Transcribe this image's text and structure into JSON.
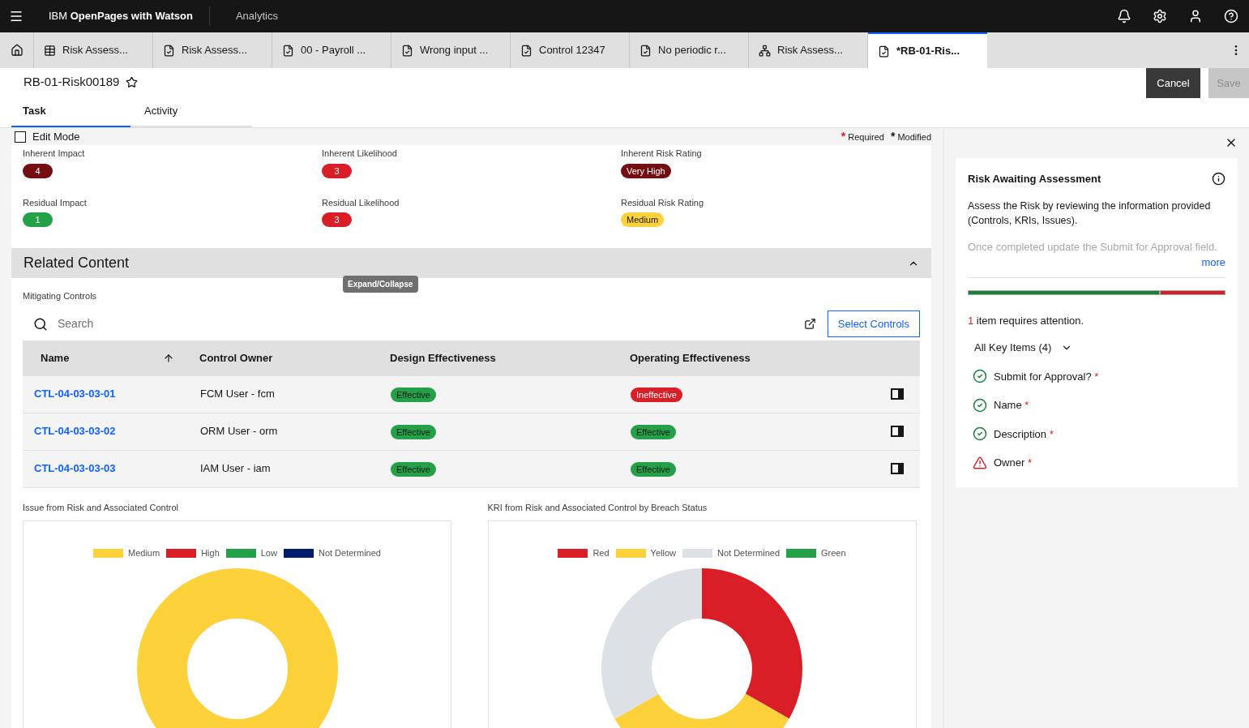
{
  "header": {
    "product": "IBM **OpenPages with Watson**",
    "section": "Analytics"
  },
  "tabs": [
    {
      "label": "Risk Assess...",
      "kind": "table",
      "selected": false
    },
    {
      "label": "Risk Assess...",
      "kind": "document",
      "selected": false
    },
    {
      "label": "00 - Payroll ...",
      "kind": "document",
      "selected": false
    },
    {
      "label": "Wrong input ...",
      "kind": "document",
      "selected": false
    },
    {
      "label": "Control 12347",
      "kind": "document",
      "selected": false
    },
    {
      "label": "No periodic r...",
      "kind": "document",
      "selected": false
    },
    {
      "label": "Risk Assess...",
      "kind": "hierarchy",
      "selected": false
    },
    {
      "label": "*RB-01-Ris...",
      "kind": "document",
      "selected": true
    }
  ],
  "page": {
    "title": "RB-01-Risk00189",
    "favorite": false,
    "buttons": [
      {
        "label": "Cancel",
        "disabled": false
      },
      {
        "label": "Save",
        "disabled": true
      }
    ]
  },
  "view_tabs": [
    {
      "label": "Task",
      "selected": true
    },
    {
      "label": "Activity",
      "selected": false
    }
  ],
  "edit_mode": {
    "label": "Edit Mode",
    "checked": false
  },
  "legend_notes": [
    {
      "mark": "*",
      "label": "Required",
      "color": "#da1e28"
    },
    {
      "mark": "*",
      "label": "Modified",
      "color": "#161616"
    }
  ],
  "ratings": [
    {
      "label": "Inherent Impact",
      "value": "4",
      "color": "#750e13"
    },
    {
      "label": "Inherent Likelihood",
      "value": "3",
      "color": "#da1e28"
    },
    {
      "label": "Inherent Risk Rating",
      "value": "Very High",
      "color": "#750e13"
    },
    {
      "label": "Residual Impact",
      "value": "1",
      "color": "#24a148"
    },
    {
      "label": "Residual Likelihood",
      "value": "3",
      "color": "#da1e28"
    },
    {
      "label": "Residual Risk Rating",
      "value": "Medium",
      "color": "#fdd13a"
    }
  ],
  "related": {
    "title": "Related Content",
    "expanded": true,
    "tooltip": "Expand/Collapse"
  },
  "controls": {
    "label": "Mitigating Controls",
    "search_placeholder": "Search",
    "button": "Select Controls",
    "columns": [
      "Name",
      "Control Owner",
      "Design Effectiveness",
      "Operating Effectiveness"
    ],
    "rows": [
      {
        "name": "CTL-04-03-03-01",
        "owner": "FCM User - fcm",
        "design": {
          "text": "Effective",
          "color": "#24a148"
        },
        "operating": {
          "text": "Ineffective",
          "color": "#da1e28"
        }
      },
      {
        "name": "CTL-04-03-03-02",
        "owner": "ORM User - orm",
        "design": {
          "text": "Effective",
          "color": "#24a148"
        },
        "operating": {
          "text": "Effective",
          "color": "#24a148"
        }
      },
      {
        "name": "CTL-04-03-03-03",
        "owner": "IAM User - iam",
        "design": {
          "text": "Effective",
          "color": "#24a148"
        },
        "operating": {
          "text": "Effective",
          "color": "#24a148"
        }
      }
    ]
  },
  "charts": [
    {
      "title": "Issue from Risk and Associated Control",
      "kind": "full",
      "legend": [
        {
          "label": "Medium",
          "color": "#fdd13a"
        },
        {
          "label": "High",
          "color": "#da1e28"
        },
        {
          "label": "Low",
          "color": "#24a148"
        },
        {
          "label": "Not Determined",
          "color": "#001d6c"
        }
      ]
    },
    {
      "title": "KRI from Risk and Associated Control by Breach Status",
      "kind": "split",
      "legend": [
        {
          "label": "Red",
          "color": "#da1e28"
        },
        {
          "label": "Yellow",
          "color": "#fdd13a"
        },
        {
          "label": "Not Determined",
          "color": "#dde1e6"
        },
        {
          "label": "Green",
          "color": "#24a148"
        }
      ]
    }
  ],
  "panel": {
    "title": "Risk Awaiting Assessment",
    "text": "Assess the Risk by reviewing the information provided (Controls, KRIs, Issues).",
    "text2": "Once completed update the Submit for Approval field.",
    "more": "more",
    "progress": {
      "level": 0.75
    },
    "attention_count": "1",
    "attention_text": "item requires attention.",
    "filter": "All Key Items (4)",
    "items": [
      {
        "label": "Submit for Approval?",
        "kind": "ok"
      },
      {
        "label": "Name",
        "kind": "ok"
      },
      {
        "label": "Description",
        "kind": "ok"
      },
      {
        "label": "Owner",
        "kind": "warning"
      }
    ]
  }
}
